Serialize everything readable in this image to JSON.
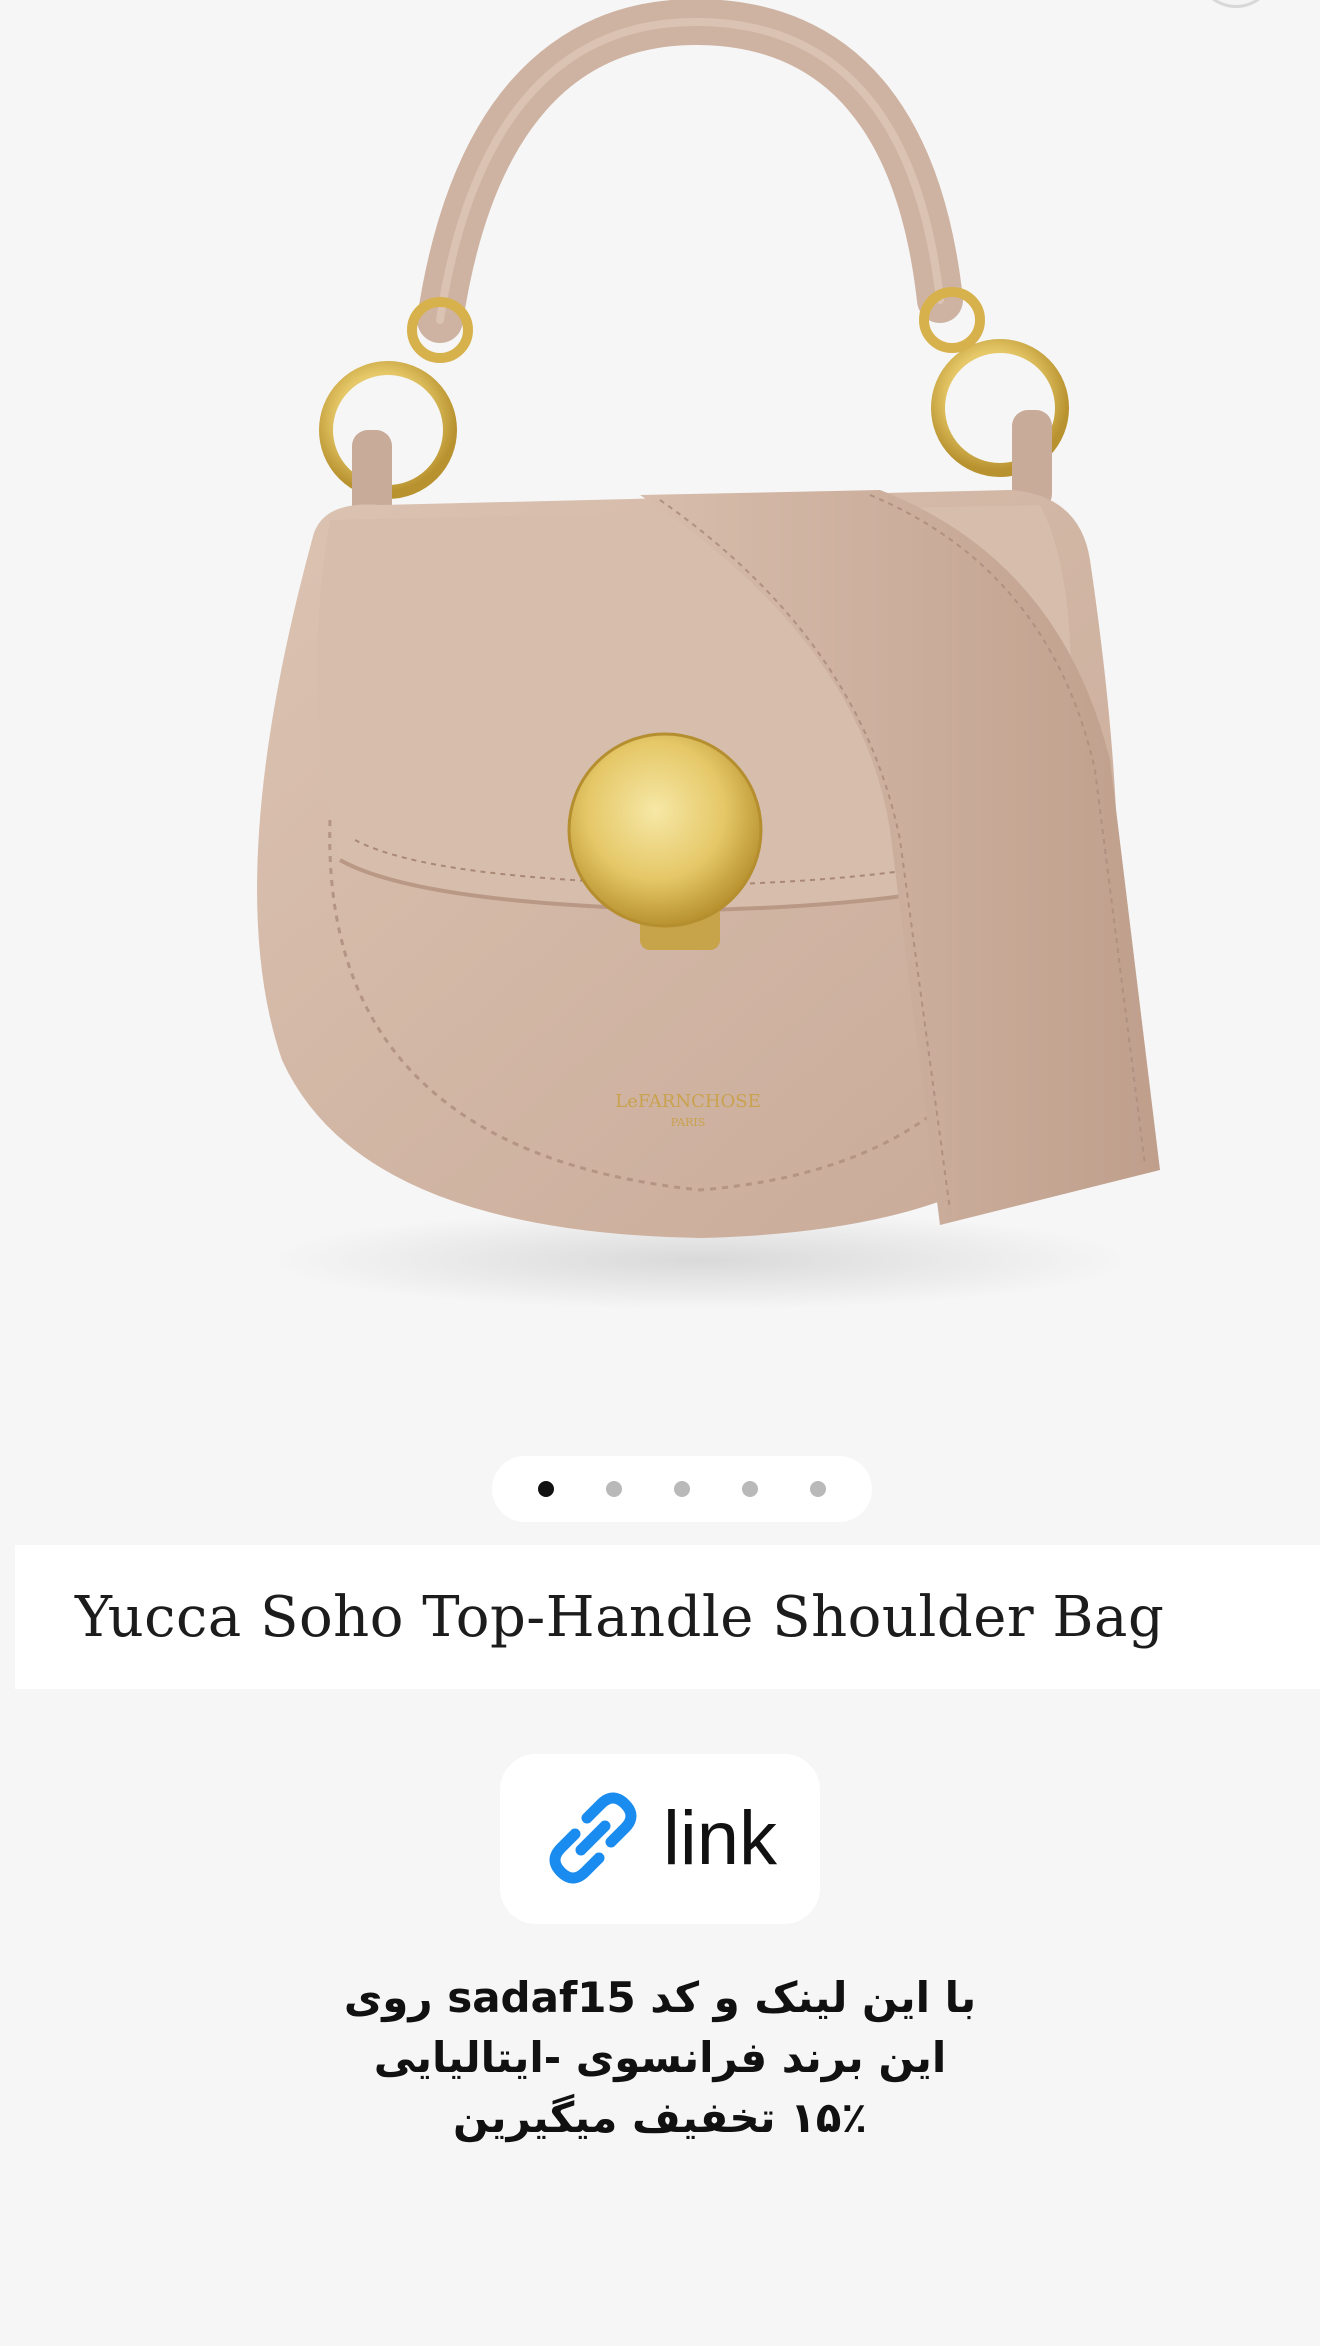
{
  "product": {
    "title": "Yucca Soho Top-Handle Shoulder Bag",
    "image_icon": "handbag-photo",
    "brand_stamp": "LeFARNCHOSE",
    "brand_city": "PARIS"
  },
  "gallery": {
    "total": 5,
    "active_index": 0
  },
  "link_button": {
    "label": "link",
    "icon": "chain-link-icon",
    "icon_color": "#1a8cf0"
  },
  "caption": {
    "lines": [
      "با این لینک و کد sadaf15 روی",
      "این برند فرانسوی -ایتالیایی",
      "۱۵٪ تخفیف میگیرین"
    ]
  },
  "colors": {
    "background": "#f6f6f6",
    "bag": "#d4b9a8",
    "hardware": "#d9b24a"
  }
}
